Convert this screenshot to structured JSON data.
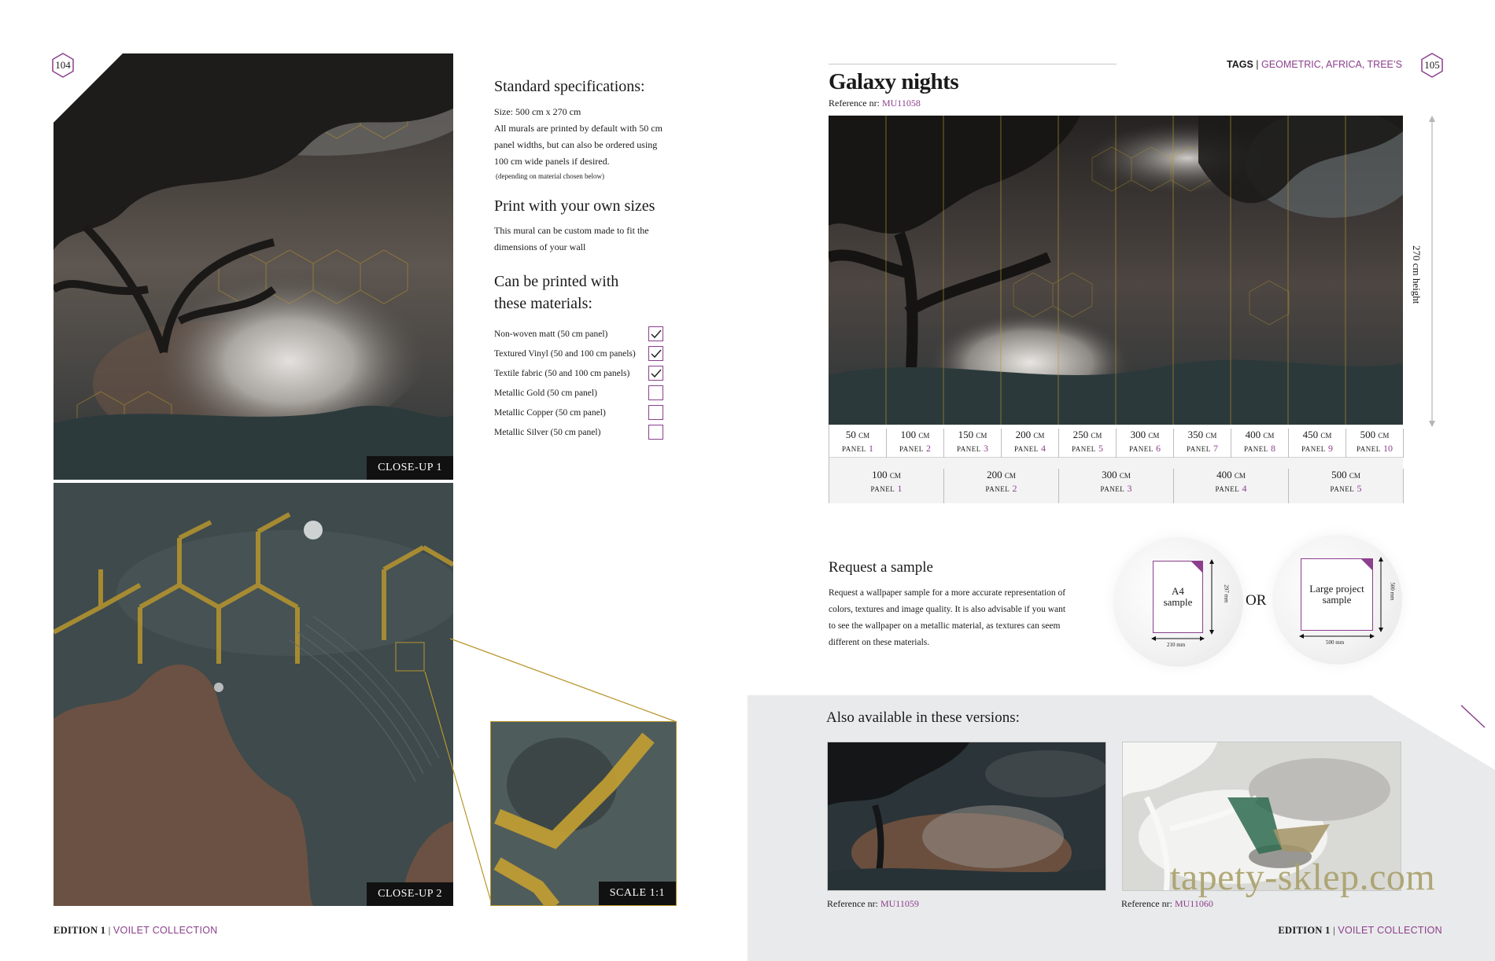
{
  "left_page": {
    "page_number": "104",
    "closeup1_label": "CLOSE-UP 1",
    "closeup2_label": "CLOSE-UP 2",
    "scale_label": "SCALE  1:1",
    "specs": {
      "title": "Standard specifications:",
      "size": "Size: 500 cm x 270 cm",
      "desc_line1": "All murals are printed by default with 50 cm",
      "desc_line2": "panel widths, but can also be ordered using",
      "desc_line3": "100 cm wide panels if desired.",
      "note": "(depending on material chosen below)"
    },
    "own_sizes": {
      "title": "Print with your own sizes",
      "line1": "This mural can be custom made to fit the",
      "line2": "dimensions of your wall"
    },
    "materials": {
      "title_line1": "Can be printed with",
      "title_line2": "these materials:",
      "items": [
        {
          "label": "Non-woven matt  (50 cm panel)",
          "checked": true
        },
        {
          "label": "Textured Vinyl (50 and 100 cm panels)",
          "checked": true
        },
        {
          "label": "Textile fabric (50 and 100 cm panels)",
          "checked": true
        },
        {
          "label": "Metallic Gold  (50 cm panel)",
          "checked": false
        },
        {
          "label": "Metallic Copper (50 cm panel)",
          "checked": false
        },
        {
          "label": "Metallic Silver (50 cm panel)",
          "checked": false
        }
      ]
    },
    "footer": {
      "edition": "EDITION 1",
      "sep": " | ",
      "collection": "VOILET COLLECTION"
    }
  },
  "right_page": {
    "page_number": "105",
    "tags_label": "TAGS",
    "tags_sep": " | ",
    "tags_value": "GEOMETRIC, AFRICA, TREE’S",
    "title": "Galaxy nights",
    "reference_label": "Reference nr: ",
    "reference_value": "MU11058",
    "height_label": "270 cm height",
    "panels_50": [
      {
        "cm": "50",
        "n": "1"
      },
      {
        "cm": "100",
        "n": "2"
      },
      {
        "cm": "150",
        "n": "3"
      },
      {
        "cm": "200",
        "n": "4"
      },
      {
        "cm": "250",
        "n": "5"
      },
      {
        "cm": "300",
        "n": "6"
      },
      {
        "cm": "350",
        "n": "7"
      },
      {
        "cm": "400",
        "n": "8"
      },
      {
        "cm": "450",
        "n": "9"
      },
      {
        "cm": "500",
        "n": "10"
      }
    ],
    "panels_100": [
      {
        "cm": "100",
        "n": "1"
      },
      {
        "cm": "200",
        "n": "2"
      },
      {
        "cm": "300",
        "n": "3"
      },
      {
        "cm": "400",
        "n": "4"
      },
      {
        "cm": "500",
        "n": "5"
      }
    ],
    "cm_unit": "CM",
    "panel_word": "PANEL",
    "sample": {
      "title": "Request a sample",
      "line1": "Request a wallpaper sample for a more accurate representation of",
      "line2": "colors, textures and image quality. It is also advisable if you want",
      "line3": "to see the wallpaper on a metallic material, as textures can seem",
      "line4": "different on these materials.",
      "a4_line1": "A4",
      "a4_line2": "sample",
      "a4_width": "210 mm",
      "a4_height": "297 mm",
      "or": "OR",
      "large_line1": "Large project",
      "large_line2": "sample",
      "large_width": "500 mm",
      "large_height": "500 mm"
    },
    "versions": {
      "title": "Also available in these versions:",
      "items": [
        {
          "ref_label": "Reference nr: ",
          "ref_value": "MU11059"
        },
        {
          "ref_label": "Reference nr: ",
          "ref_value": "MU11060"
        }
      ]
    },
    "watermark": "tapety-sklep.com",
    "footer": {
      "edition": "EDITION 1",
      "sep": " | ",
      "collection": "VOILET COLLECTION"
    }
  },
  "colors": {
    "accent": "#8b3f8c",
    "gold": "#b8962e",
    "grey_band": "#e9eaeb"
  }
}
